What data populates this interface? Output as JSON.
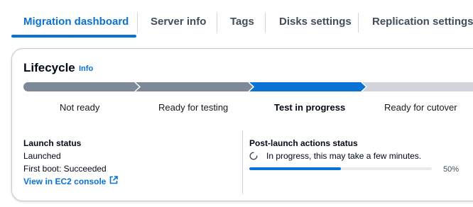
{
  "tabs": [
    {
      "label": "Migration dashboard",
      "active": true
    },
    {
      "label": "Server info",
      "active": false
    },
    {
      "label": "Tags",
      "active": false
    },
    {
      "label": "Disks settings",
      "active": false
    },
    {
      "label": "Replication settings",
      "active": false
    }
  ],
  "lifecycle": {
    "title": "Lifecycle",
    "info_label": "Info",
    "steps": [
      {
        "label": "Not ready",
        "state": "complete"
      },
      {
        "label": "Ready for testing",
        "state": "complete"
      },
      {
        "label": "Test in progress",
        "state": "current"
      },
      {
        "label": "Ready for cutover",
        "state": "pending"
      }
    ]
  },
  "launch_status": {
    "title": "Launch status",
    "status": "Launched",
    "first_boot": "First boot: Succeeded",
    "link_label": "View in EC2 console"
  },
  "post_launch": {
    "title": "Post-launch actions status",
    "message": "In progress, this may take a few minutes.",
    "progress_percent": 50,
    "progress_label": "50%"
  },
  "colors": {
    "accent": "#0972d3",
    "complete": "#7d8998",
    "pending": "#d1d5db"
  },
  "icons": {
    "info": "info-link",
    "external_link": "external-link-icon",
    "spinner": "spinner-icon"
  }
}
